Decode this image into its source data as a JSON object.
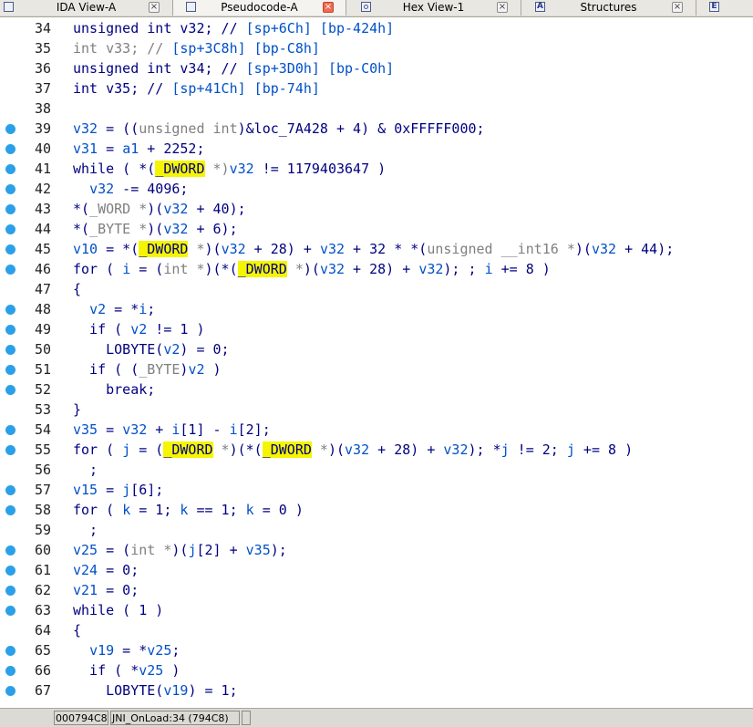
{
  "tabs": [
    {
      "label": "IDA View-A",
      "closable": true,
      "active": false
    },
    {
      "label": "Pseudocode-A",
      "closable": true,
      "active": true
    },
    {
      "label": "Hex View-1",
      "closable": true,
      "active": false
    },
    {
      "label": "Structures",
      "closable": true,
      "active": false
    }
  ],
  "colors": {
    "keyword": "#000080",
    "variable": "#0050c8",
    "comment": "#0050c8",
    "stack_ref": "#7f7f7f",
    "type_gray": "#7f7f7f",
    "highlight": "#f5f500",
    "breakpoint_dot": "#2ba0e8"
  },
  "code_lines": [
    {
      "num": "34",
      "dot": false,
      "segs": [
        [
          "unsigned int v32; // ",
          "k"
        ],
        [
          "[sp+6Ch] [bp-424h]",
          "v"
        ]
      ]
    },
    {
      "num": "35",
      "dot": false,
      "segs": [
        [
          "int v33; // ",
          "g"
        ],
        [
          "[sp+3C8h] [bp-C8h]",
          "v"
        ]
      ]
    },
    {
      "num": "36",
      "dot": false,
      "segs": [
        [
          "unsigned int v34; // ",
          "k"
        ],
        [
          "[sp+3D0h] [bp-C0h]",
          "v"
        ]
      ]
    },
    {
      "num": "37",
      "dot": false,
      "segs": [
        [
          "int v35; // ",
          "k"
        ],
        [
          "[sp+41Ch] [bp-74h]",
          "v"
        ]
      ]
    },
    {
      "num": "38",
      "dot": false,
      "segs": []
    },
    {
      "num": "39",
      "dot": true,
      "segs": [
        [
          "v32",
          "v"
        ],
        [
          " = ((",
          "k"
        ],
        [
          "unsigned int",
          "g"
        ],
        [
          ")&loc_7A428 + 4) & 0xFFFFF000;",
          "k"
        ]
      ]
    },
    {
      "num": "40",
      "dot": true,
      "segs": [
        [
          "v31",
          "v"
        ],
        [
          " = ",
          "k"
        ],
        [
          "a1",
          "v"
        ],
        [
          " + 2252;",
          "k"
        ]
      ]
    },
    {
      "num": "41",
      "dot": true,
      "segs": [
        [
          "while ( *(",
          "k"
        ],
        [
          "_DWORD",
          "h"
        ],
        [
          " *)",
          "g"
        ],
        [
          "v32",
          "v"
        ],
        [
          " != 1179403647 )",
          "k"
        ]
      ]
    },
    {
      "num": "42",
      "dot": true,
      "segs": [
        [
          "  ",
          "k"
        ],
        [
          "v32",
          "v"
        ],
        [
          " -= 4096;",
          "k"
        ]
      ]
    },
    {
      "num": "43",
      "dot": true,
      "segs": [
        [
          "*(",
          "k"
        ],
        [
          "_WORD *",
          "g"
        ],
        [
          ")(",
          "k"
        ],
        [
          "v32",
          "v"
        ],
        [
          " + 40);",
          "k"
        ]
      ]
    },
    {
      "num": "44",
      "dot": true,
      "segs": [
        [
          "*(",
          "k"
        ],
        [
          "_BYTE *",
          "g"
        ],
        [
          ")(",
          "k"
        ],
        [
          "v32",
          "v"
        ],
        [
          " + 6);",
          "k"
        ]
      ]
    },
    {
      "num": "45",
      "dot": true,
      "segs": [
        [
          "v10",
          "v"
        ],
        [
          " = *(",
          "k"
        ],
        [
          "_DWORD",
          "h"
        ],
        [
          " *",
          "g"
        ],
        [
          ")(",
          "k"
        ],
        [
          "v32",
          "v"
        ],
        [
          " + 28) + ",
          "k"
        ],
        [
          "v32",
          "v"
        ],
        [
          " + 32 * *(",
          "k"
        ],
        [
          "unsigned __int16 *",
          "g"
        ],
        [
          ")(",
          "k"
        ],
        [
          "v32",
          "v"
        ],
        [
          " + 44);",
          "k"
        ]
      ]
    },
    {
      "num": "46",
      "dot": true,
      "segs": [
        [
          "for ( ",
          "k"
        ],
        [
          "i",
          "v"
        ],
        [
          " = (",
          "k"
        ],
        [
          "int *",
          "g"
        ],
        [
          ")(*(",
          "k"
        ],
        [
          "_DWORD",
          "h"
        ],
        [
          " *",
          "g"
        ],
        [
          ")(",
          "k"
        ],
        [
          "v32",
          "v"
        ],
        [
          " + 28) + ",
          "k"
        ],
        [
          "v32",
          "v"
        ],
        [
          "); ; ",
          "k"
        ],
        [
          "i",
          "v"
        ],
        [
          " += 8 )",
          "k"
        ]
      ]
    },
    {
      "num": "47",
      "dot": false,
      "segs": [
        [
          "{",
          "k"
        ]
      ]
    },
    {
      "num": "48",
      "dot": true,
      "segs": [
        [
          "  ",
          "k"
        ],
        [
          "v2",
          "v"
        ],
        [
          " = *",
          "k"
        ],
        [
          "i",
          "v"
        ],
        [
          ";",
          "k"
        ]
      ]
    },
    {
      "num": "49",
      "dot": true,
      "segs": [
        [
          "  if ( ",
          "k"
        ],
        [
          "v2",
          "v"
        ],
        [
          " != 1 )",
          "k"
        ]
      ]
    },
    {
      "num": "50",
      "dot": true,
      "segs": [
        [
          "    LOBYTE(",
          "k"
        ],
        [
          "v2",
          "v"
        ],
        [
          ") = 0;",
          "k"
        ]
      ]
    },
    {
      "num": "51",
      "dot": true,
      "segs": [
        [
          "  if ( (",
          "k"
        ],
        [
          "_BYTE",
          "g"
        ],
        [
          ")",
          "k"
        ],
        [
          "v2",
          "v"
        ],
        [
          " )",
          "k"
        ]
      ]
    },
    {
      "num": "52",
      "dot": true,
      "segs": [
        [
          "    break;",
          "k"
        ]
      ]
    },
    {
      "num": "53",
      "dot": false,
      "segs": [
        [
          "}",
          "k"
        ]
      ]
    },
    {
      "num": "54",
      "dot": true,
      "segs": [
        [
          "v35",
          "v"
        ],
        [
          " = ",
          "k"
        ],
        [
          "v32",
          "v"
        ],
        [
          " + ",
          "k"
        ],
        [
          "i",
          "v"
        ],
        [
          "[1] - ",
          "k"
        ],
        [
          "i",
          "v"
        ],
        [
          "[2];",
          "k"
        ]
      ]
    },
    {
      "num": "55",
      "dot": true,
      "segs": [
        [
          "for ( ",
          "k"
        ],
        [
          "j",
          "v"
        ],
        [
          " = (",
          "k"
        ],
        [
          "_DWORD",
          "h"
        ],
        [
          " *",
          "g"
        ],
        [
          ")(*(",
          "k"
        ],
        [
          "_DWORD",
          "h"
        ],
        [
          " *",
          "g"
        ],
        [
          ")(",
          "k"
        ],
        [
          "v32",
          "v"
        ],
        [
          " + 28) + ",
          "k"
        ],
        [
          "v32",
          "v"
        ],
        [
          "); *",
          "k"
        ],
        [
          "j",
          "v"
        ],
        [
          " != 2; ",
          "k"
        ],
        [
          "j",
          "v"
        ],
        [
          " += 8 )",
          "k"
        ]
      ]
    },
    {
      "num": "56",
      "dot": false,
      "segs": [
        [
          "  ;",
          "k"
        ]
      ]
    },
    {
      "num": "57",
      "dot": true,
      "segs": [
        [
          "v15",
          "v"
        ],
        [
          " = ",
          "k"
        ],
        [
          "j",
          "v"
        ],
        [
          "[6];",
          "k"
        ]
      ]
    },
    {
      "num": "58",
      "dot": true,
      "segs": [
        [
          "for ( ",
          "k"
        ],
        [
          "k",
          "v"
        ],
        [
          " = 1; ",
          "k"
        ],
        [
          "k",
          "v"
        ],
        [
          " == 1; ",
          "k"
        ],
        [
          "k",
          "v"
        ],
        [
          " = 0 )",
          "k"
        ]
      ]
    },
    {
      "num": "59",
      "dot": false,
      "segs": [
        [
          "  ;",
          "k"
        ]
      ]
    },
    {
      "num": "60",
      "dot": true,
      "segs": [
        [
          "v25",
          "v"
        ],
        [
          " = (",
          "k"
        ],
        [
          "int *",
          "g"
        ],
        [
          ")(",
          "k"
        ],
        [
          "j",
          "v"
        ],
        [
          "[2] + ",
          "k"
        ],
        [
          "v35",
          "v"
        ],
        [
          ");",
          "k"
        ]
      ]
    },
    {
      "num": "61",
      "dot": true,
      "segs": [
        [
          "v24",
          "v"
        ],
        [
          " = 0;",
          "k"
        ]
      ]
    },
    {
      "num": "62",
      "dot": true,
      "segs": [
        [
          "v21",
          "v"
        ],
        [
          " = 0;",
          "k"
        ]
      ]
    },
    {
      "num": "63",
      "dot": true,
      "segs": [
        [
          "while ( 1 )",
          "k"
        ]
      ]
    },
    {
      "num": "64",
      "dot": false,
      "segs": [
        [
          "{",
          "k"
        ]
      ]
    },
    {
      "num": "65",
      "dot": true,
      "segs": [
        [
          "  ",
          "k"
        ],
        [
          "v19",
          "v"
        ],
        [
          " = *",
          "k"
        ],
        [
          "v25",
          "v"
        ],
        [
          ";",
          "k"
        ]
      ]
    },
    {
      "num": "66",
      "dot": true,
      "segs": [
        [
          "  if ( *",
          "k"
        ],
        [
          "v25",
          "v"
        ],
        [
          " )",
          "k"
        ]
      ]
    },
    {
      "num": "67",
      "dot": true,
      "segs": [
        [
          "    LOBYTE(",
          "k"
        ],
        [
          "v19",
          "v"
        ],
        [
          ") = 1;",
          "k"
        ]
      ]
    }
  ],
  "status": {
    "address": "000794C8",
    "location": "JNI_OnLoad:34 (794C8)"
  }
}
